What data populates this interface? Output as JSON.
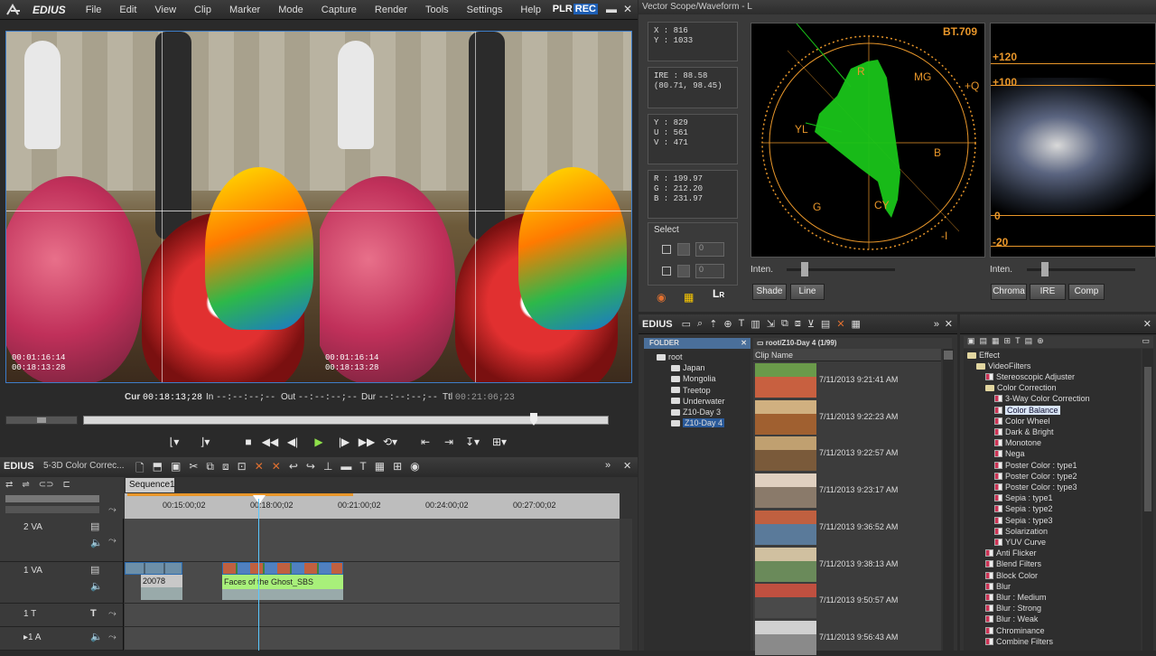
{
  "app": {
    "logo": "EDIUS",
    "plr": "PLR",
    "rec": "REC"
  },
  "menu": [
    "File",
    "Edit",
    "View",
    "Clip",
    "Marker",
    "Mode",
    "Capture",
    "Render",
    "Tools",
    "Settings",
    "Help"
  ],
  "preview": {
    "tc_a1": "00:01:16:14",
    "tc_a2": "00:18:13:28",
    "tc_b1": "00:01:16:14",
    "tc_b2": "00:18:13:28"
  },
  "timecodes": {
    "cur_label": "Cur",
    "cur": "00:18:13;28",
    "in_label": "In",
    "in": "--:--:--;--",
    "out_label": "Out",
    "out": "--:--:--;--",
    "dur_label": "Dur",
    "dur": "--:--:--;--",
    "ttl_label": "Ttl",
    "ttl": "00:21:06;23"
  },
  "timeline": {
    "title": "EDIUS",
    "project": "5-3D Color Correc...",
    "sequence_tab": "Sequence1",
    "ruler": [
      "00:15:00;02",
      "00:18:00;02",
      "00:21:00;02",
      "00:24:00;02",
      "00:27:00;02"
    ],
    "tracks": [
      {
        "name": "2 VA"
      },
      {
        "name": "1 VA"
      },
      {
        "name": "1 T"
      },
      {
        "name": "▸1 A"
      }
    ],
    "clip_a_label": "20078",
    "clip_b_label": "Faces of the Ghost_SBS"
  },
  "scope": {
    "title": "Vector Scope/Waveform - L",
    "xy": [
      "X : 816",
      "Y : 1033"
    ],
    "ire": [
      "IRE : 88.58",
      "(80.71, 98.45)"
    ],
    "yuv": [
      "Y : 829",
      "U : 561",
      "V : 471"
    ],
    "rgb": [
      "R : 199.97",
      "G : 212.20",
      "B : 231.97"
    ],
    "select_label": "Select",
    "select_values": [
      "0",
      "0"
    ],
    "standard": "BT.709",
    "vec_labels": {
      "r": "R",
      "mg": "MG",
      "q": "+Q",
      "yl": "YL",
      "b": "B",
      "g": "G",
      "cy": "CY",
      "i": "-I"
    },
    "wave_labels": {
      "p120": "+120",
      "p100": "+100",
      "zero": "0",
      "m20": "-20"
    },
    "inten_label": "Inten.",
    "buttons_left": [
      "Shade",
      "Line"
    ],
    "buttons_right": [
      "Chroma",
      "IRE",
      "Comp"
    ],
    "lr_label": "L",
    "lr_sub": "R"
  },
  "bin": {
    "title": "EDIUS",
    "folder_header": "FOLDER",
    "path": "root/Z10-Day 4 (1/99)",
    "col_header": "Clip Name",
    "folders": [
      "root",
      "Japan",
      "Mongolia",
      "Treetop",
      "Underwater",
      "Z10-Day 3",
      "Z10-Day 4"
    ],
    "clips": [
      "7/11/2013 9:21:41 AM",
      "7/11/2013 9:22:23 AM",
      "7/11/2013 9:22:57 AM",
      "7/11/2013 9:23:17 AM",
      "7/11/2013 9:36:52 AM",
      "7/11/2013 9:38:13 AM",
      "7/11/2013 9:50:57 AM",
      "7/11/2013 9:56:43 AM"
    ]
  },
  "effects": {
    "root": "Effect",
    "videofilters": "VideoFilters",
    "items": [
      {
        "label": "Stereoscopic Adjuster",
        "type": "fx",
        "indent": 2
      },
      {
        "label": "Color Correction",
        "type": "folder",
        "indent": 2
      },
      {
        "label": "3-Way Color Correction",
        "type": "fx",
        "indent": 3
      },
      {
        "label": "Color Balance",
        "type": "fx",
        "indent": 3,
        "selected": true
      },
      {
        "label": "Color Wheel",
        "type": "fx",
        "indent": 3
      },
      {
        "label": "Dark & Bright",
        "type": "fx",
        "indent": 3
      },
      {
        "label": "Monotone",
        "type": "fx",
        "indent": 3
      },
      {
        "label": "Nega",
        "type": "fx",
        "indent": 3
      },
      {
        "label": "Poster Color : type1",
        "type": "fx",
        "indent": 3
      },
      {
        "label": "Poster Color : type2",
        "type": "fx",
        "indent": 3
      },
      {
        "label": "Poster Color : type3",
        "type": "fx",
        "indent": 3
      },
      {
        "label": "Sepia : type1",
        "type": "fx",
        "indent": 3
      },
      {
        "label": "Sepia : type2",
        "type": "fx",
        "indent": 3
      },
      {
        "label": "Sepia : type3",
        "type": "fx",
        "indent": 3
      },
      {
        "label": "Solarization",
        "type": "fx",
        "indent": 3
      },
      {
        "label": "YUV Curve",
        "type": "fx",
        "indent": 3
      },
      {
        "label": "Anti Flicker",
        "type": "fx",
        "indent": 2
      },
      {
        "label": "Blend Filters",
        "type": "fx",
        "indent": 2
      },
      {
        "label": "Block Color",
        "type": "fx",
        "indent": 2
      },
      {
        "label": "Blur",
        "type": "fx",
        "indent": 2
      },
      {
        "label": "Blur : Medium",
        "type": "fx",
        "indent": 2
      },
      {
        "label": "Blur : Strong",
        "type": "fx",
        "indent": 2
      },
      {
        "label": "Blur : Weak",
        "type": "fx",
        "indent": 2
      },
      {
        "label": "Chrominance",
        "type": "fx",
        "indent": 2
      },
      {
        "label": "Combine Filters",
        "type": "fx",
        "indent": 2
      }
    ]
  },
  "colors": {
    "accent": "#3d7dc9",
    "scope_green": "#19c419",
    "scope_orange": "#e8962a",
    "clip_green": "#a8f07a"
  }
}
